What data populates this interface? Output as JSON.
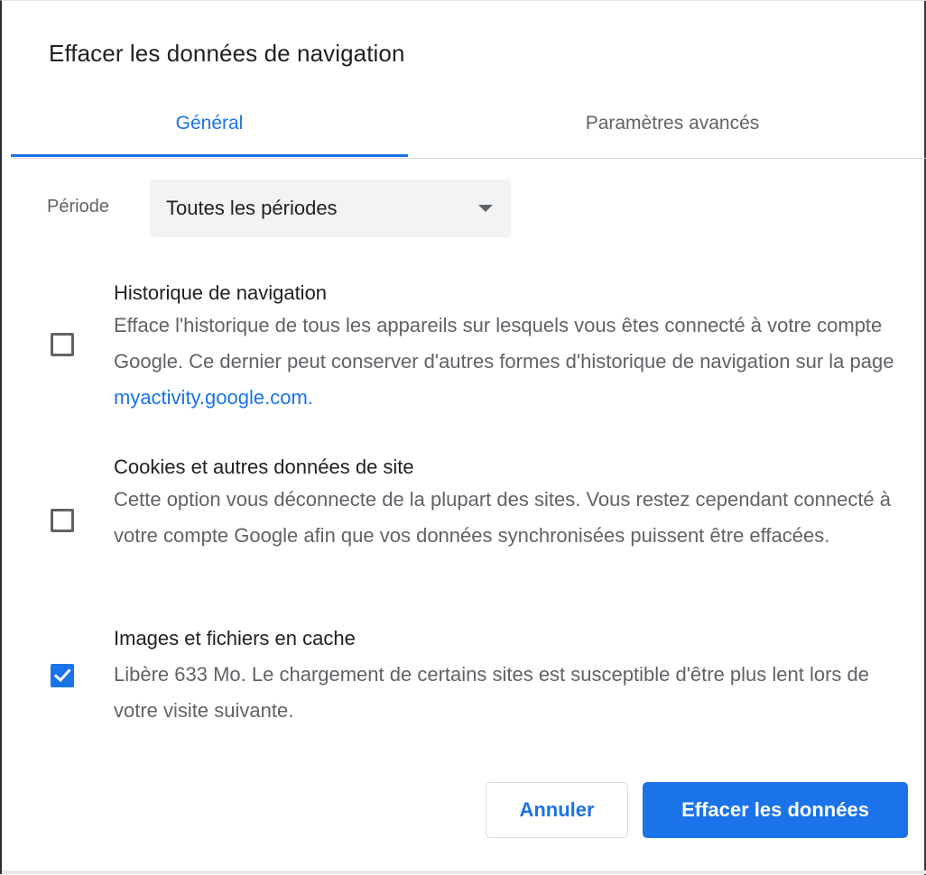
{
  "dialog": {
    "title": "Effacer les données de navigation"
  },
  "tabs": [
    {
      "label": "Général",
      "selected": true
    },
    {
      "label": "Paramètres avancés",
      "selected": false
    }
  ],
  "period": {
    "label": "Période",
    "value": "Toutes les périodes"
  },
  "options": [
    {
      "title": "Historique de navigation",
      "description_before_link": "Efface l'historique de tous les appareils sur lesquels vous êtes connecté à votre compte Google. Ce dernier peut conserver d'autres formes d'historique de navigation sur la page ",
      "link": "myactivity.google.com.",
      "checked": false
    },
    {
      "title": "Cookies et autres données de site",
      "description": "Cette option vous déconnecte de la plupart des sites. Vous restez cependant connecté à votre compte Google afin que vos données synchronisées puissent être effacées.",
      "checked": false
    },
    {
      "title": "Images et fichiers en cache",
      "description": "Libère 633 Mo. Le chargement de certains sites est susceptible d'être plus lent lors de votre visite suivante.",
      "checked": true
    }
  ],
  "buttons": {
    "cancel": "Annuler",
    "clear": "Effacer les données"
  },
  "colors": {
    "accent": "#1a73e8",
    "text_primary": "#202124",
    "text_secondary": "#5f6368"
  }
}
